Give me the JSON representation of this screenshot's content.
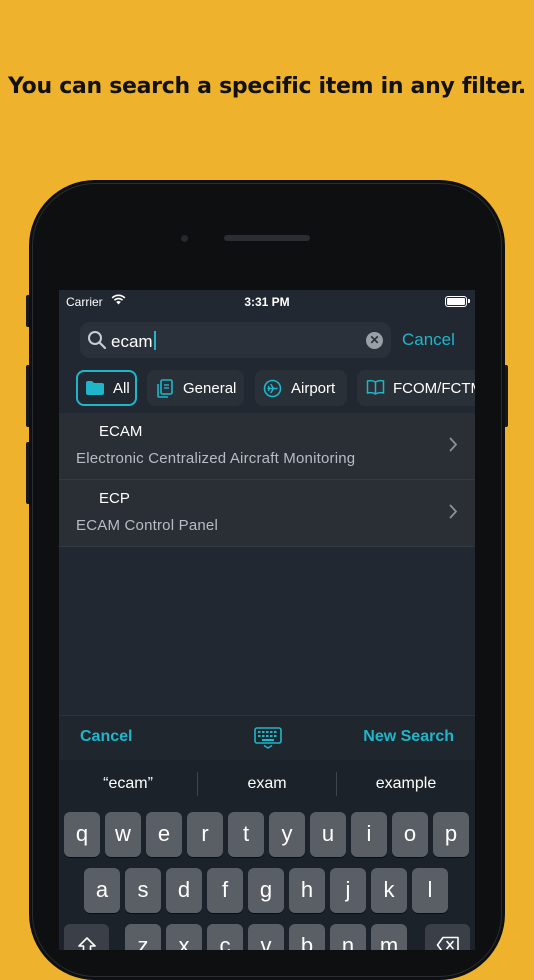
{
  "headline": "You can search a specific item in any filter.",
  "status": {
    "carrier": "Carrier",
    "time": "3:31 PM"
  },
  "search": {
    "value": "ecam",
    "cancel": "Cancel"
  },
  "filters": [
    {
      "label": "All",
      "icon": "folder-icon",
      "active": true
    },
    {
      "label": "General",
      "icon": "documents-icon",
      "active": false
    },
    {
      "label": "Airport",
      "icon": "airplane-icon",
      "active": false
    },
    {
      "label": "FCOM/FCTM",
      "icon": "book-icon",
      "active": false
    }
  ],
  "results": [
    {
      "title": "ECAM",
      "subtitle": "Electronic Centralized Aircraft Monitoring"
    },
    {
      "title": "ECP",
      "subtitle": "ECAM Control Panel"
    }
  ],
  "toolbar": {
    "cancel": "Cancel",
    "new_search": "New Search",
    "icon": "keyboard-icon"
  },
  "suggestions": [
    "“ecam”",
    "exam",
    "example"
  ],
  "keys": {
    "row1": [
      "q",
      "w",
      "e",
      "r",
      "t",
      "y",
      "u",
      "i",
      "o",
      "p"
    ],
    "row2": [
      "a",
      "s",
      "d",
      "f",
      "g",
      "h",
      "j",
      "k",
      "l"
    ],
    "row3": [
      "z",
      "x",
      "c",
      "v",
      "b",
      "n",
      "m"
    ]
  },
  "colors": {
    "background": "#EEB22C",
    "accent": "#1FB6C9",
    "screen": "#222831"
  }
}
